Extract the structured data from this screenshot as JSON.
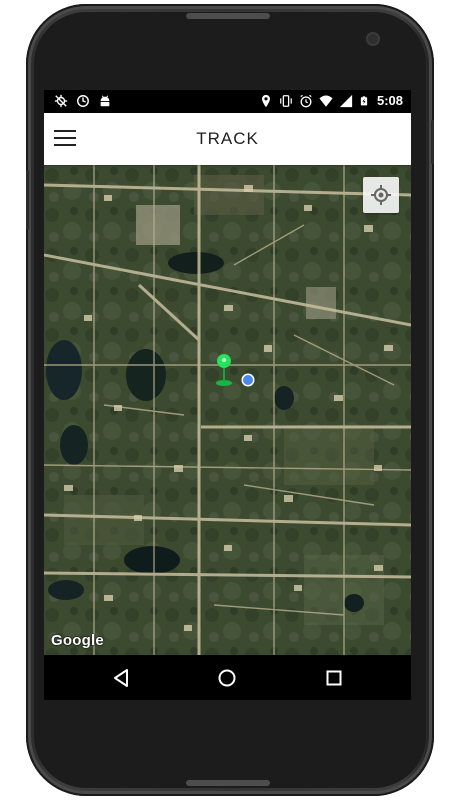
{
  "status_bar": {
    "time": "5:08",
    "left_icons": [
      "no-gps-icon",
      "alarm-clock-icon",
      "android-icon"
    ],
    "right_icons": [
      "location-pin-icon",
      "vibrate-icon",
      "alarm-icon",
      "wifi-icon",
      "signal-icon",
      "battery-charging-icon"
    ]
  },
  "app_bar": {
    "title": "TRACK",
    "menu_icon": "hamburger-menu-icon"
  },
  "map": {
    "attribution": "Google",
    "map_type": "satellite",
    "markers": [
      {
        "type": "destination-pin",
        "color": "#22e35a"
      },
      {
        "type": "current-location-dot",
        "color": "#4a88f0"
      }
    ],
    "locate_button_icon": "my-location-icon"
  },
  "nav_bar": {
    "buttons": [
      "back-icon",
      "home-icon",
      "recents-icon"
    ]
  },
  "colors": {
    "app_bar_bg": "#ffffff",
    "pin_green": "#22e35a",
    "location_blue": "#4a88f0"
  }
}
